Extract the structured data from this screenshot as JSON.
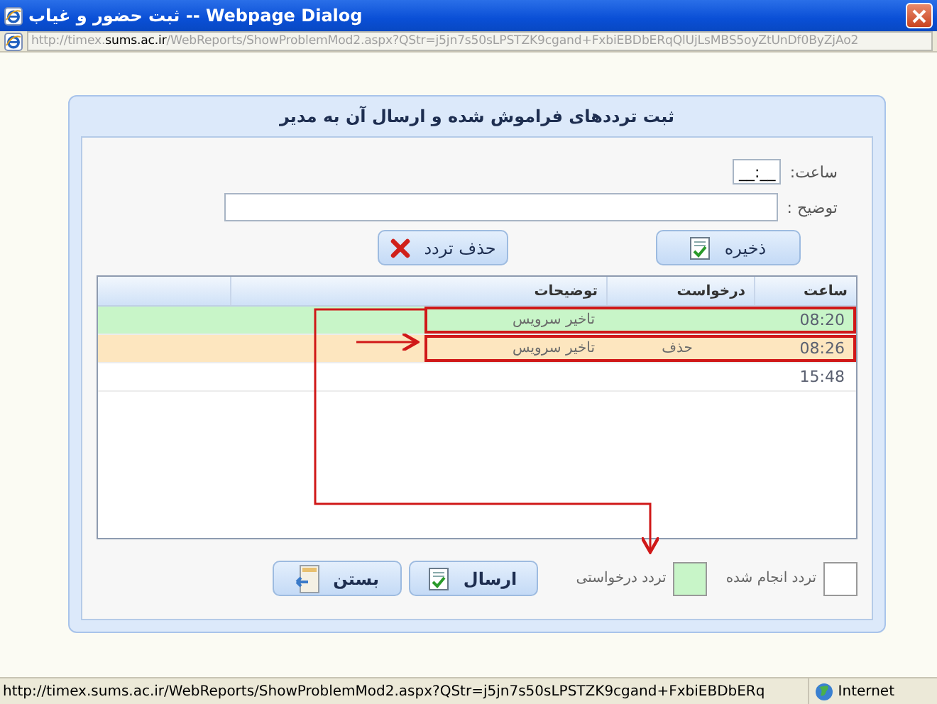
{
  "window": {
    "title": "ثبت حضور و غیاب -- Webpage Dialog"
  },
  "address": {
    "prefix": "http://timex.",
    "host": "sums.ac.ir",
    "path": "/WebReports/ShowProblemMod2.aspx?QStr=j5jn7s50sLPSTZK9cgand+FxbiEBDbERqQlUjLsMBS5oyZtUnDf0ByZjAo2"
  },
  "panel": {
    "title": "ثبت ترددهای فراموش شده و ارسال آن به مدیر"
  },
  "form": {
    "time_label": "ساعت:",
    "time_value": "__:__",
    "note_label": "توضیح :"
  },
  "form_buttons": [
    {
      "label": "ذخیره",
      "kind": "save"
    },
    {
      "label": "حذف تردد",
      "kind": "delete"
    }
  ],
  "table": {
    "columns": [
      "ساعت",
      "درخواست",
      "توضیحات"
    ],
    "rows": [
      {
        "time": "08:20",
        "request": "",
        "note": "تاخیر سرویس",
        "color": "#c8f5c8",
        "framed": true
      },
      {
        "time": "08:26",
        "request": "حذف",
        "note": "تاخیر سرویس",
        "color": "#fde6bf",
        "framed": true
      },
      {
        "time": "15:48",
        "request": "",
        "note": "",
        "color": "#ffffff",
        "framed": false
      }
    ]
  },
  "legend": [
    {
      "label": "تردد انجام شده",
      "color": "#ffffff"
    },
    {
      "label": "تردد درخواستی",
      "color": "#c8f5c8"
    }
  ],
  "bottom_buttons": [
    {
      "label": "ارسال",
      "kind": "send"
    },
    {
      "label": "بستن",
      "kind": "close"
    }
  ],
  "status_bar": {
    "url": "http://timex.sums.ac.ir/WebReports/ShowProblemMod2.aspx?QStr=j5jn7s50sLPSTZK9cgand+FxbiEBDbERq",
    "zone": "Internet"
  }
}
